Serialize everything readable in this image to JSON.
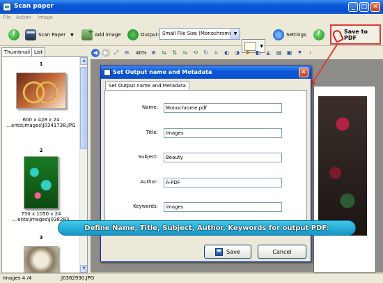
{
  "window": {
    "title": "Scan paper",
    "minimize": "_",
    "maximize": "□",
    "close": "✕"
  },
  "menu": [
    "File",
    "Action",
    "Image"
  ],
  "toolbar": {
    "scan_label": "Scan Paper",
    "add_image_label": "Add image",
    "output_label": "Output:",
    "output_value": "Small File Size (Monochrome)",
    "settings_label": "Settings",
    "save_pdf_label": "Save to PDF"
  },
  "left_tabs": [
    "Thumbnail",
    "List"
  ],
  "thumbnails": [
    {
      "num": "1",
      "size": "600 x 428 x 24",
      "path": "...ents\\images\\J0341738.JPG"
    },
    {
      "num": "2",
      "size": "750 x 1050 x 24",
      "path": "...ents\\images\\J038283"
    },
    {
      "num": "3",
      "size": "",
      "path": ""
    }
  ],
  "viewer": {
    "zoom": "40%"
  },
  "status": {
    "images": "Images 4 /4",
    "file": "J0382930.JPG"
  },
  "dialog": {
    "title": "Set Output name and Metadata",
    "tab": "Set Output name and Metadata",
    "fields": [
      {
        "label": "Name:",
        "value": "Monochrome.pdf"
      },
      {
        "label": "Title:",
        "value": "Images"
      },
      {
        "label": "Subject:",
        "value": "Beauty"
      },
      {
        "label": "Author:",
        "value": "A-PDF"
      },
      {
        "label": "Keywords:",
        "value": "images"
      }
    ],
    "save_label": "Save",
    "cancel_label": "Cancel"
  },
  "callout": "Define Name, Title, Subject, Author, Keywords for output PDF:",
  "colors": {
    "titlebar": "#0a58d8",
    "highlight_border": "#d83a3a",
    "callout_bg": "#1595c8"
  }
}
